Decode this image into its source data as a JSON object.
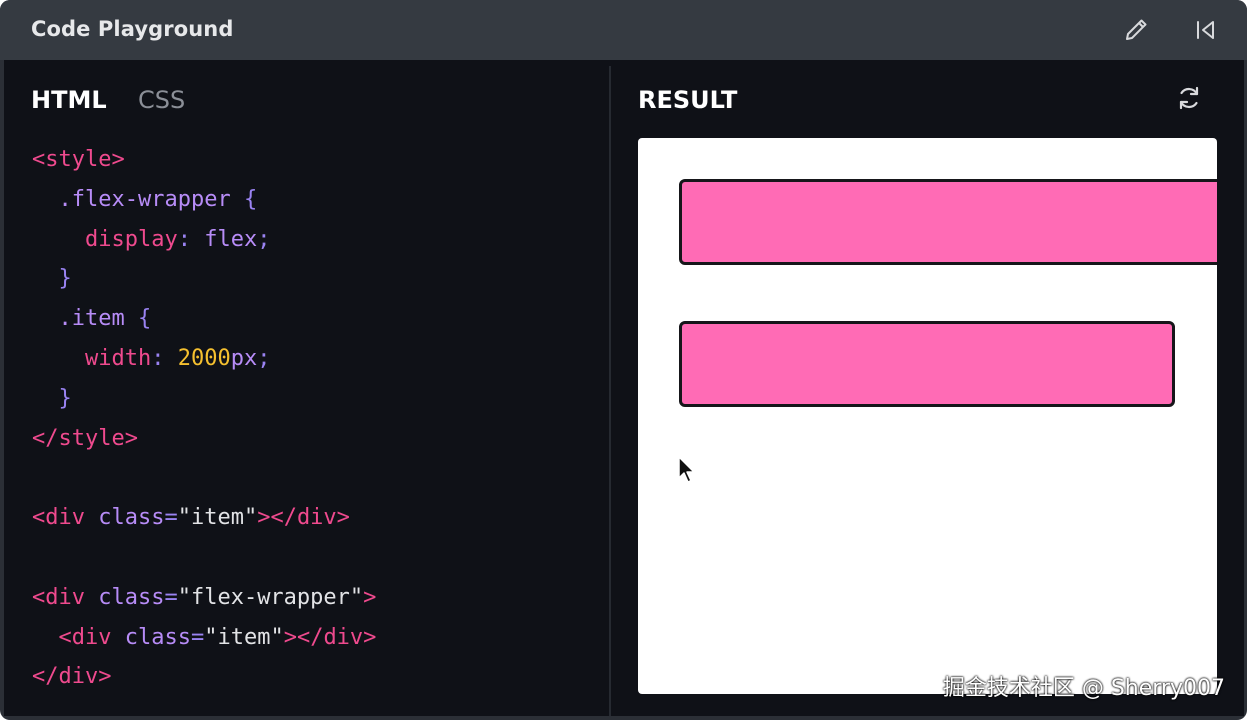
{
  "app": {
    "title": "Code Playground"
  },
  "toolbar": {
    "edit_icon": "pencil-icon",
    "collapse_icon": "collapse-left-icon"
  },
  "editor": {
    "tabs": [
      {
        "label": "HTML",
        "active": true
      },
      {
        "label": "CSS",
        "active": false
      }
    ],
    "lines": [
      [
        {
          "t": "tag",
          "v": "<style>"
        }
      ],
      [
        {
          "t": "plain",
          "v": "  "
        },
        {
          "t": "selector",
          "v": ".flex-wrapper"
        },
        {
          "t": "plain",
          "v": " "
        },
        {
          "t": "brace",
          "v": "{"
        }
      ],
      [
        {
          "t": "plain",
          "v": "    "
        },
        {
          "t": "prop",
          "v": "display"
        },
        {
          "t": "punct",
          "v": ": "
        },
        {
          "t": "val",
          "v": "flex"
        },
        {
          "t": "punct",
          "v": ";"
        }
      ],
      [
        {
          "t": "plain",
          "v": "  "
        },
        {
          "t": "brace",
          "v": "}"
        }
      ],
      [
        {
          "t": "plain",
          "v": "  "
        },
        {
          "t": "selector",
          "v": ".item"
        },
        {
          "t": "plain",
          "v": " "
        },
        {
          "t": "brace",
          "v": "{"
        }
      ],
      [
        {
          "t": "plain",
          "v": "    "
        },
        {
          "t": "prop",
          "v": "width"
        },
        {
          "t": "punct",
          "v": ": "
        },
        {
          "t": "num",
          "v": "2000"
        },
        {
          "t": "unit",
          "v": "px"
        },
        {
          "t": "punct",
          "v": ";"
        }
      ],
      [
        {
          "t": "plain",
          "v": "  "
        },
        {
          "t": "brace",
          "v": "}"
        }
      ],
      [
        {
          "t": "tag",
          "v": "</style>"
        }
      ],
      [],
      [
        {
          "t": "tag",
          "v": "<div"
        },
        {
          "t": "plain",
          "v": " "
        },
        {
          "t": "attr",
          "v": "class"
        },
        {
          "t": "punct",
          "v": "="
        },
        {
          "t": "str",
          "v": "\"item\""
        },
        {
          "t": "tag",
          "v": "></div>"
        }
      ],
      [],
      [
        {
          "t": "tag",
          "v": "<div"
        },
        {
          "t": "plain",
          "v": " "
        },
        {
          "t": "attr",
          "v": "class"
        },
        {
          "t": "punct",
          "v": "="
        },
        {
          "t": "str",
          "v": "\"flex-wrapper\""
        },
        {
          "t": "tag",
          "v": ">"
        }
      ],
      [
        {
          "t": "plain",
          "v": "  "
        },
        {
          "t": "tag",
          "v": "<div"
        },
        {
          "t": "plain",
          "v": " "
        },
        {
          "t": "attr",
          "v": "class"
        },
        {
          "t": "punct",
          "v": "="
        },
        {
          "t": "str",
          "v": "\"item\""
        },
        {
          "t": "tag",
          "v": "></div>"
        }
      ],
      [
        {
          "t": "tag",
          "v": "</div>"
        }
      ]
    ]
  },
  "result": {
    "label": "RESULT",
    "refresh_icon": "refresh-icon",
    "item_color": "#ff6bb5"
  },
  "watermark": {
    "text": "掘金技术社区 @ Sherry007"
  },
  "colors": {
    "titlebar": "#353a41",
    "editor_bg": "#0f1117",
    "tag": "#ef4a8e",
    "selector": "#b78cf7",
    "number": "#f5c02f"
  }
}
